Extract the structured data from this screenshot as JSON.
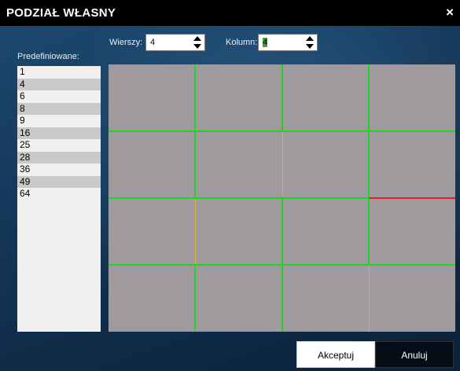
{
  "dialog": {
    "title": "PODZIAŁ WŁASNY",
    "close_glyph": "×"
  },
  "rows_field": {
    "label": "Wierszy:",
    "value": "4"
  },
  "cols_field": {
    "label": "Kolumn:",
    "value": "4"
  },
  "presets": {
    "label": "Predefiniowane:",
    "items": [
      "1",
      "4",
      "6",
      "8",
      "9",
      "16",
      "25",
      "28",
      "36",
      "49",
      "64"
    ]
  },
  "grid": {
    "rows": 4,
    "columns": 4,
    "cell_color": "#9f9a9d",
    "divider_color": "#22d422",
    "split_hint_color": "#e0c040",
    "selected_edge_color": "#e02020"
  },
  "buttons": {
    "accept": "Akceptuj",
    "cancel": "Anuluj"
  }
}
